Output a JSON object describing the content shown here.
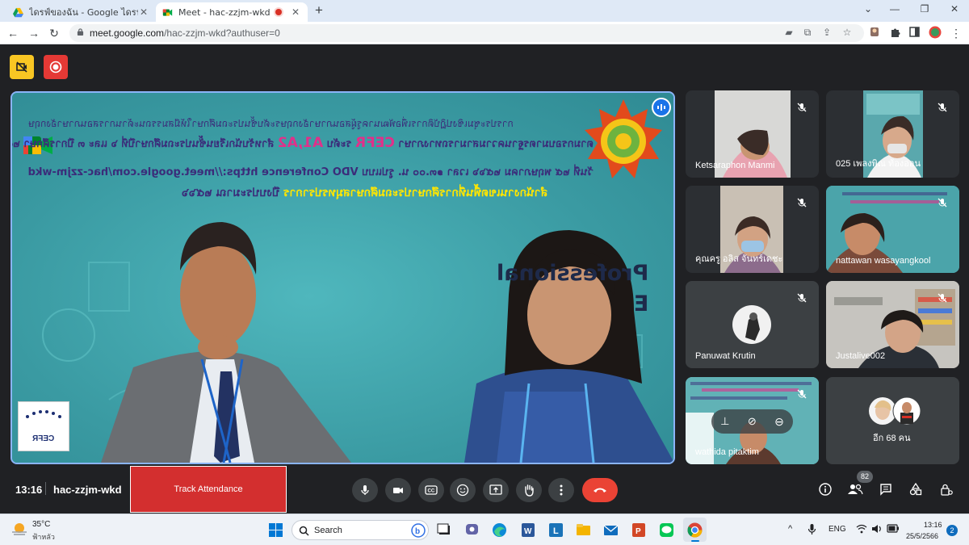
{
  "browser": {
    "tabs": [
      {
        "title": "ไดรฟ์ของฉัน - Google ไดรฟ์",
        "icon": "google-drive-icon"
      },
      {
        "title": "Meet - hac-zzjm-wkd",
        "icon": "google-meet-icon",
        "recording": true
      }
    ],
    "url_host": "meet.google.com",
    "url_path": "/hac-zzjm-wkd?authuser=0"
  },
  "stage": {
    "banner": {
      "line1": "การประชุมเชิงปฏิบัติการเพื่อพัฒนาครูผู้สอนภาษาอังกฤษระดับชั้นประถมศึกษาให้มีสมรรถนะด้านการสอนภาษาอังกฤษ",
      "line2_pre": "ตามกรอบมาตรฐานความสามารถทางภาษา",
      "line2_cefr": "CEFR",
      "line2_mid": "ระดับ",
      "line2_level": "A1,A2",
      "line2_post": "สำหรับนักเรียนชั้นประถมศึกษาปีที่ ๖ และ ๓ ปีการศึกษา ๒๕๖๖",
      "line3": "วันที่ ๒๕ พฤษภาคม ๒๕๖๖ เวลา ๑๓.๐๐ น. รูปแบบ VDO Conference https://meet.google.com/hac-zzjm-wkd",
      "line4_office": "สำนักงานเขตพื้นที่การศึกษาประถมศึกษาสมุทรปราการ",
      "line4_rest": "ปีงบประมาณ ๒๕๖๖"
    },
    "side_text": [
      "Professional",
      "E"
    ],
    "logo_text": "CEFR"
  },
  "participants": [
    {
      "name": "Ketsaraphon Manmi",
      "bg": "#b7b3ae"
    },
    {
      "name": "025 เพลงพิณ ท้องอ่อน",
      "bg": "#5aa8ad"
    },
    {
      "name": "คุณครู อลิส จันทร์เดชะ",
      "bg": "#c9c0b4"
    },
    {
      "name": "nattawan wasayangkool",
      "bg": "#4ba4aa"
    },
    {
      "name": "Panuwat Krutin",
      "bg": "#3c4043"
    },
    {
      "name": "Justalive002",
      "bg": "#8a8a86"
    },
    {
      "name": "wathida pitaktim",
      "bg": "#61b2b6"
    },
    {
      "name": "อีก 68 คน",
      "bg": "#3c4043"
    }
  ],
  "bottom": {
    "time": "13:16",
    "meeting_code": "hac-zzjm-wkd",
    "track_label": "Track Attendance",
    "people_count": "82"
  },
  "taskbar": {
    "temp": "35°C",
    "weather_desc": "ฟ้าหลัว",
    "search_label": "Search",
    "lang": "ENG",
    "clock_time": "13:16",
    "clock_date": "25/5/2566",
    "notif_count": "2"
  }
}
